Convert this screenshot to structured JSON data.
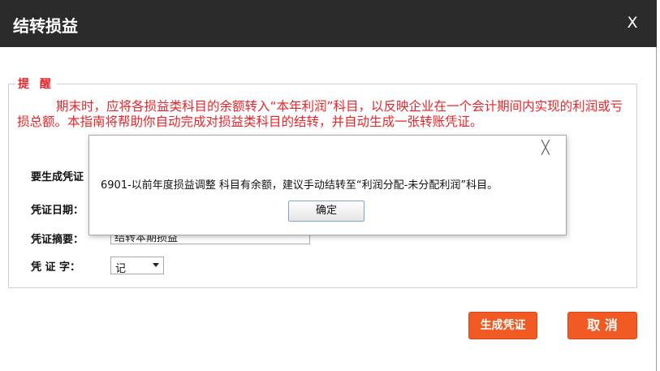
{
  "dialog": {
    "title": "结转损益",
    "close_glyph": "X"
  },
  "reminder": {
    "legend": "提 醒",
    "text": "期末时，应将各损益类科目的余额转入“本年利润”科目，以反映企业在一个会计期间内实现的利润或亏损总额。本指南将帮助你自动完成对损益类科目的结转，并自动生成一张转账凭证。"
  },
  "form": {
    "voucher_type_label": "要生成凭证",
    "voucher_date_label": "凭证日期：",
    "voucher_summary_label": "凭证摘要：",
    "voucher_summary_value": "结转本期损益",
    "voucher_word_label": "凭 证 字：",
    "voucher_word_value": "记"
  },
  "buttons": {
    "generate": "生成凭证",
    "cancel": "取 消"
  },
  "message_box": {
    "close_glyph": "╳",
    "message": "6901-以前年度损益调整 科目有余额，建议手动结转至“利润分配-未分配利润”科目。",
    "ok": "确定"
  },
  "colors": {
    "titlebar": "#2b2b2b",
    "reminder_text": "#e8252a",
    "button_accent": "#f15a22"
  }
}
